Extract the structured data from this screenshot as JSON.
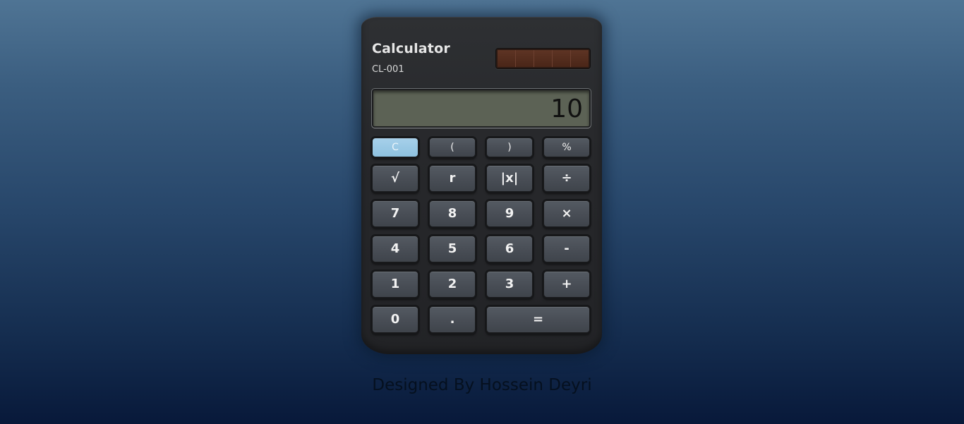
{
  "calculator": {
    "title": "Calculator",
    "model": "CL-001",
    "display_value": "10"
  },
  "buttons": {
    "clear": "C",
    "open_paren": "(",
    "close_paren": ")",
    "percent": "%",
    "sqrt": "√",
    "r": "r",
    "abs": "|x|",
    "divide": "÷",
    "seven": "7",
    "eight": "8",
    "nine": "9",
    "multiply": "×",
    "four": "4",
    "five": "5",
    "six": "6",
    "minus": "-",
    "one": "1",
    "two": "2",
    "three": "3",
    "plus": "+",
    "zero": "0",
    "decimal": ".",
    "equals": "="
  },
  "footer": {
    "credit": "Designed By Hossein Deyri"
  },
  "colors": {
    "clear_button": "#8ec1df",
    "body": "#27282b",
    "screen": "#5c6255"
  }
}
